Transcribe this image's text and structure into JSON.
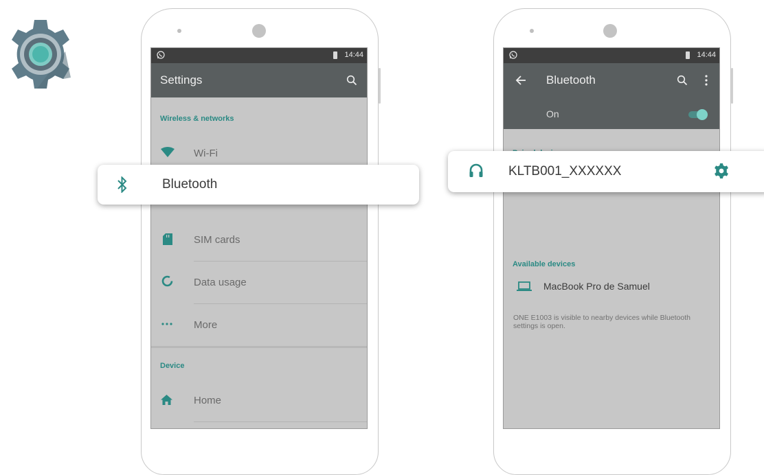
{
  "colors": {
    "accent": "#2b8a84",
    "appbar": "#595e5f",
    "statusbar": "#3e3e3e",
    "screen": "#c7c7c7"
  },
  "app_icon": {
    "icon": "settings-gear-icon"
  },
  "left_phone": {
    "status": {
      "time": "14:44",
      "icons": [
        "whatsapp-icon",
        "battery-icon"
      ]
    },
    "appbar": {
      "title": "Settings",
      "icons": [
        "search-icon"
      ]
    },
    "sections": [
      {
        "header": "Wireless & networks",
        "items": [
          {
            "label": "Wi-Fi",
            "icon": "wifi-icon"
          },
          {
            "label": "Bluetooth",
            "icon": "bluetooth-icon"
          },
          {
            "label": "SIM cards",
            "icon": "sim-card-icon"
          },
          {
            "label": "Data usage",
            "icon": "data-usage-icon"
          },
          {
            "label": "More",
            "icon": "more-dots-icon"
          }
        ]
      },
      {
        "header": "Device",
        "items": [
          {
            "label": "Home",
            "icon": "home-icon"
          }
        ]
      }
    ]
  },
  "right_phone": {
    "status": {
      "time": "14:44",
      "icons": [
        "whatsapp-icon",
        "battery-icon"
      ]
    },
    "appbar": {
      "title": "Bluetooth",
      "icons": [
        "back-arrow-icon",
        "search-icon",
        "overflow-menu-icon"
      ]
    },
    "toggle": {
      "label": "On",
      "state": "on"
    },
    "paired_header": "Paired devices",
    "paired_devices": [
      {
        "name": "KLTB001_XXXXXX",
        "icon": "headphones-icon",
        "action_icon": "gear-icon"
      }
    ],
    "available_header": "Available devices",
    "available_devices": [
      {
        "name": "MacBook Pro de Samuel",
        "icon": "laptop-icon"
      }
    ],
    "visibility_note": "ONE E1003 is visible to nearby devices while Bluetooth settings is open."
  },
  "callouts": {
    "bluetooth": {
      "label": "Bluetooth",
      "icon": "bluetooth-icon"
    },
    "paired_device": {
      "label": "KLTB001_XXXXXX",
      "icon": "headphones-icon",
      "action_icon": "gear-icon"
    }
  }
}
